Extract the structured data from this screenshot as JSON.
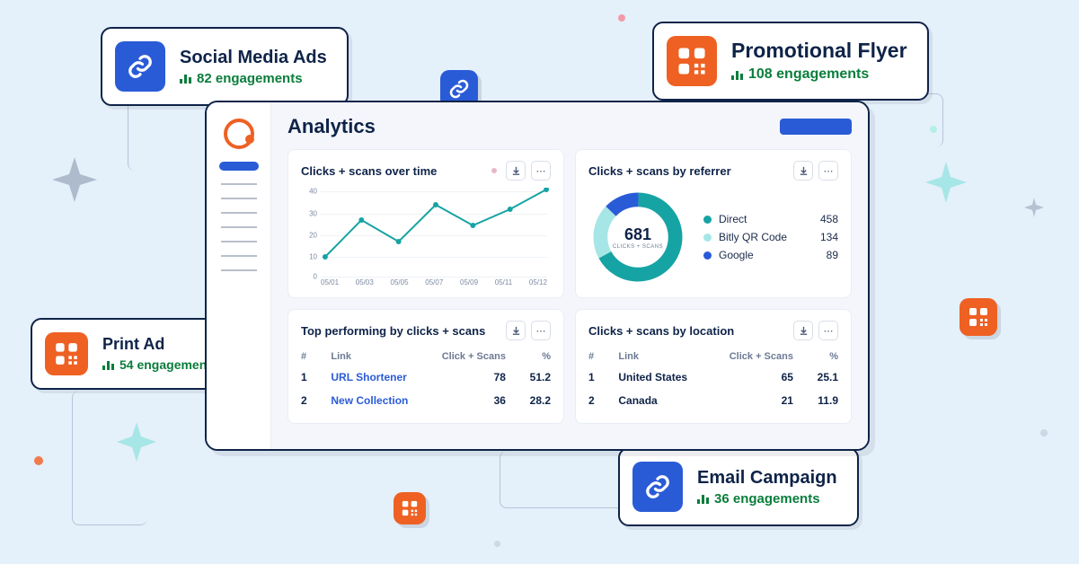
{
  "colors": {
    "blue": "#2a5bd7",
    "orange": "#ee6123",
    "teal": "#16a3a3",
    "lightteal": "#a7e6e6",
    "deepblue": "#2a5bd7",
    "green": "#0a7d3b"
  },
  "callouts": {
    "social": {
      "title": "Social Media Ads",
      "engagements": "82 engagements",
      "icon": "link",
      "tile": "blue"
    },
    "promo": {
      "title": "Promotional Flyer",
      "engagements": "108 engagements",
      "icon": "qr",
      "tile": "orange"
    },
    "print": {
      "title": "Print Ad",
      "engagements": "54 engagements",
      "icon": "qr",
      "tile": "orange"
    },
    "email": {
      "title": "Email Campaign",
      "engagements": "36 engagements",
      "icon": "link",
      "tile": "blue"
    }
  },
  "dashboard": {
    "title": "Analytics",
    "cards": {
      "overtime": {
        "title": "Clicks + scans over time",
        "y_ticks": [
          "40",
          "30",
          "20",
          "10",
          "0"
        ],
        "x_ticks": [
          "05/01",
          "05/03",
          "05/05",
          "05/07",
          "05/09",
          "05/11",
          "05/12"
        ]
      },
      "referrer": {
        "title": "Clicks + scans by referrer",
        "center_value": "681",
        "center_label": "CLICKS + SCANS",
        "rows": [
          {
            "label": "Direct",
            "value": "458",
            "color": "#16a3a3"
          },
          {
            "label": "Bitly QR Code",
            "value": "134",
            "color": "#a7e6e6"
          },
          {
            "label": "Google",
            "value": "89",
            "color": "#2a5bd7"
          }
        ]
      },
      "top": {
        "title": "Top performing by clicks + scans",
        "headers": {
          "rank": "#",
          "link": "Link",
          "clicks": "Click + Scans",
          "pct": "%"
        },
        "rows": [
          {
            "rank": "1",
            "link": "URL Shortener",
            "clicks": "78",
            "pct": "51.2"
          },
          {
            "rank": "2",
            "link": "New Collection",
            "clicks": "36",
            "pct": "28.2"
          }
        ]
      },
      "location": {
        "title": "Clicks + scans by location",
        "headers": {
          "rank": "#",
          "link": "Link",
          "clicks": "Click + Scans",
          "pct": "%"
        },
        "rows": [
          {
            "rank": "1",
            "link": "United States",
            "clicks": "65",
            "pct": "25.1"
          },
          {
            "rank": "2",
            "link": "Canada",
            "clicks": "21",
            "pct": "11.9"
          }
        ]
      }
    }
  },
  "chart_data": [
    {
      "type": "line",
      "title": "Clicks + scans over time",
      "x": [
        "05/01",
        "05/03",
        "05/05",
        "05/07",
        "05/09",
        "05/11",
        "05/12"
      ],
      "values": [
        8,
        25,
        15,
        32,
        22,
        30,
        41
      ],
      "ylim": [
        0,
        40
      ],
      "xlabel": "",
      "ylabel": ""
    },
    {
      "type": "pie",
      "title": "Clicks + scans by referrer",
      "categories": [
        "Direct",
        "Bitly QR Code",
        "Google"
      ],
      "values": [
        458,
        134,
        89
      ],
      "total_label": "681"
    }
  ]
}
